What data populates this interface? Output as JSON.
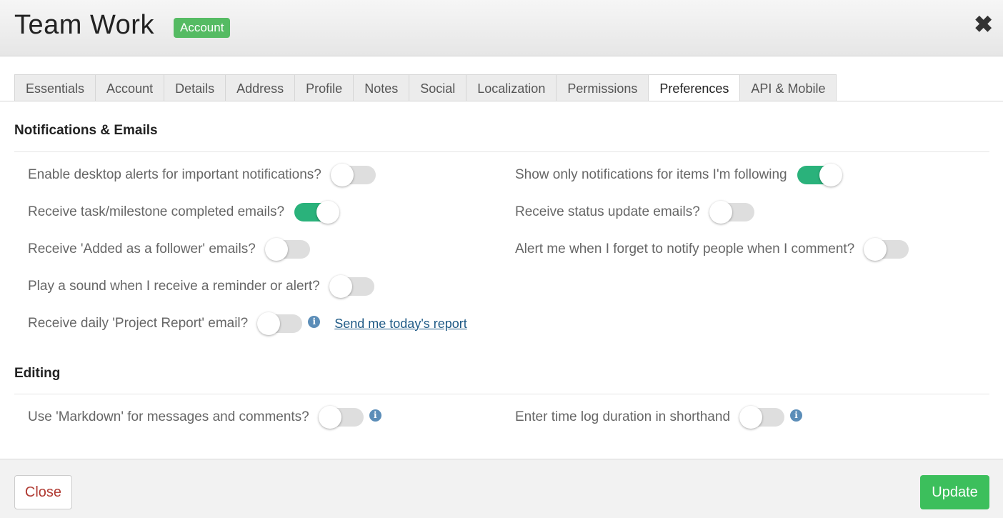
{
  "header": {
    "title": "Team Work",
    "badge": "Account",
    "close_icon": "close-icon"
  },
  "tabs": [
    {
      "label": "Essentials",
      "active": false
    },
    {
      "label": "Account",
      "active": false
    },
    {
      "label": "Details",
      "active": false
    },
    {
      "label": "Address",
      "active": false
    },
    {
      "label": "Profile",
      "active": false
    },
    {
      "label": "Notes",
      "active": false
    },
    {
      "label": "Social",
      "active": false
    },
    {
      "label": "Localization",
      "active": false
    },
    {
      "label": "Permissions",
      "active": false
    },
    {
      "label": "Preferences",
      "active": true
    },
    {
      "label": "API & Mobile",
      "active": false
    }
  ],
  "notifications": {
    "title": "Notifications & Emails",
    "left": [
      {
        "label": "Enable desktop alerts for important notifications?",
        "on": false
      },
      {
        "label": "Receive task/milestone completed emails?",
        "on": true
      },
      {
        "label": "Receive 'Added as a follower' emails?",
        "on": false
      },
      {
        "label": "Play a sound when I receive a reminder or alert?",
        "on": false
      },
      {
        "label": "Receive daily 'Project Report' email?",
        "on": false,
        "info": true,
        "link": "Send me today's report"
      }
    ],
    "right": [
      {
        "label": "Show only notifications for items I'm following",
        "on": true
      },
      {
        "label": "Receive status update emails?",
        "on": false
      },
      {
        "label": "Alert me when I forget to notify people when I comment?",
        "on": false
      }
    ]
  },
  "editing": {
    "title": "Editing",
    "left": [
      {
        "label": "Use 'Markdown' for messages and comments?",
        "on": false,
        "info": true
      }
    ],
    "right": [
      {
        "label": "Enter time log duration in shorthand",
        "on": false,
        "info": true
      }
    ]
  },
  "info_glyph": "i",
  "footer": {
    "close_label": "Close",
    "update_label": "Update"
  },
  "colors": {
    "toggle_on": "#2ab27b",
    "toggle_off": "#dedede",
    "badge": "#55bb63",
    "update_button": "#3cbf5c",
    "close_text": "#b03a32",
    "link": "#1f5a86"
  }
}
